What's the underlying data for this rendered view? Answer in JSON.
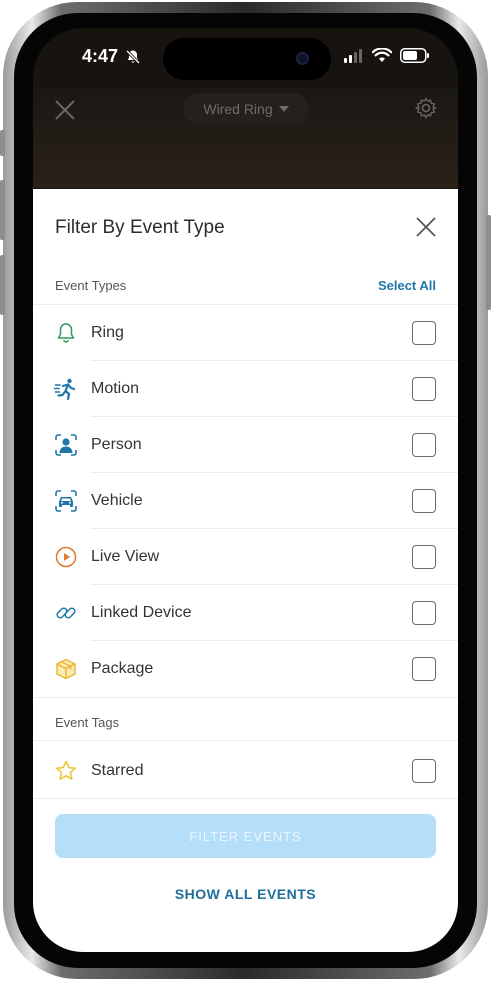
{
  "status_bar": {
    "time": "4:47"
  },
  "background_header": {
    "device_selector": "Wired Ring"
  },
  "sheet": {
    "title": "Filter By Event Type",
    "event_types": {
      "label": "Event Types",
      "select_all": "Select All",
      "items": [
        {
          "label": "Ring",
          "icon": "bell-icon",
          "checked": false
        },
        {
          "label": "Motion",
          "icon": "running-person-icon",
          "checked": false
        },
        {
          "label": "Person",
          "icon": "person-icon",
          "checked": false
        },
        {
          "label": "Vehicle",
          "icon": "car-icon",
          "checked": false
        },
        {
          "label": "Live View",
          "icon": "play-circle-icon",
          "checked": false
        },
        {
          "label": "Linked Device",
          "icon": "link-icon",
          "checked": false
        },
        {
          "label": "Package",
          "icon": "package-icon",
          "checked": false
        }
      ]
    },
    "event_tags": {
      "label": "Event Tags",
      "items": [
        {
          "label": "Starred",
          "icon": "star-icon",
          "checked": false
        }
      ]
    },
    "filter_button": "FILTER EVENTS",
    "show_all": "SHOW ALL EVENTS"
  },
  "colors": {
    "accent": "#1f77a8",
    "disabled_button": "#b5def8",
    "ring_icon": "#2e9a5c",
    "motion_icon": "#1f77a8",
    "live_view_icon": "#e07a2e",
    "package_icon": "#e8b62e",
    "star_icon": "#e8c72e"
  }
}
